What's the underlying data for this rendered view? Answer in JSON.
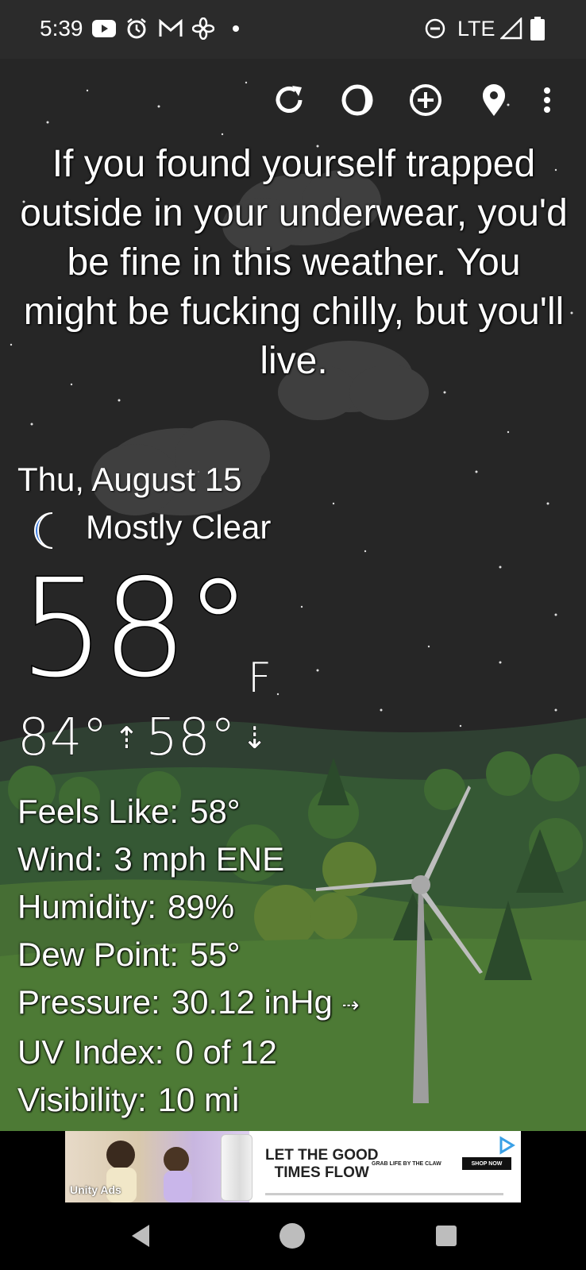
{
  "status_bar": {
    "time": "5:39",
    "network": "LTE",
    "icons": [
      "youtube-icon",
      "alarm-icon",
      "gmail-icon",
      "fan-icon",
      "dot-icon",
      "dnd-icon",
      "signal-icon",
      "battery-icon"
    ]
  },
  "toolbar": {
    "icons": [
      "refresh-icon",
      "moon-phase-icon",
      "add-location-icon",
      "location-pin-icon",
      "more-options-icon"
    ]
  },
  "weather": {
    "quote": "If you found yourself trapped outside in your underwear, you'd be fine in this weather. You might be fucking chilly, but you'll live.",
    "date": "Thu, August 15",
    "condition": "Mostly Clear",
    "condition_icon": "crescent-moon-icon",
    "temperature": "58°",
    "unit": "F",
    "high": "84°",
    "low": "58°",
    "details": [
      {
        "label": "Feels Like:",
        "value": "58°"
      },
      {
        "label": "Wind:",
        "value": "3 mph ENE"
      },
      {
        "label": "Humidity:",
        "value": "89%"
      },
      {
        "label": "Dew Point:",
        "value": "55°"
      },
      {
        "label": "Pressure:",
        "value": "30.12 inHg",
        "trend": "⇢"
      },
      {
        "label": "UV Index:",
        "value": "0 of 12"
      },
      {
        "label": "Visibility:",
        "value": "10 mi"
      }
    ]
  },
  "ad": {
    "brand": "Unity Ads",
    "headline_line1": "LET THE GOOD",
    "headline_line2": "TIMES FLOW",
    "tagline": "GRAB LIFE BY THE CLAW",
    "cta": "SHOP NOW"
  },
  "colors": {
    "status_bar": "#2b2b2b",
    "sky": "#262626",
    "moon": "#3b7be0",
    "grass": "#4d7a35"
  }
}
